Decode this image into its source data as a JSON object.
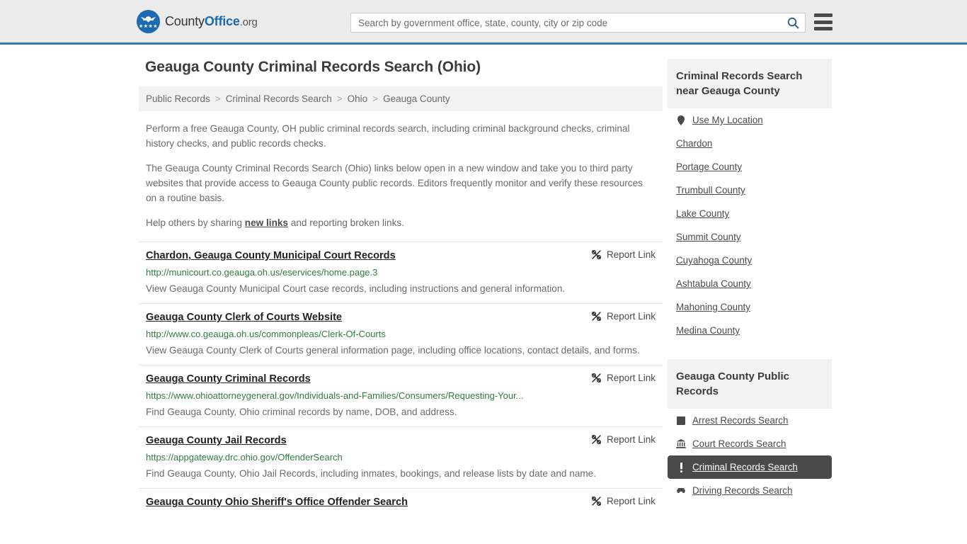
{
  "header": {
    "logo_text_1": "County",
    "logo_text_2": "Office",
    "logo_text_3": ".org",
    "logo_stars": "★★★★",
    "search_placeholder": "Search by government office, state, county, city or zip code",
    "search_value": "",
    "search_icon": "search-icon",
    "menu_icon": "hamburger-menu-icon"
  },
  "page_title": "Geauga County Criminal Records Search (Ohio)",
  "breadcrumb": {
    "items": [
      {
        "label": "Public Records"
      },
      {
        "label": "Criminal Records Search"
      },
      {
        "label": "Ohio"
      },
      {
        "label": "Geauga County"
      }
    ],
    "separator": ">"
  },
  "intro": {
    "p1": "Perform a free Geauga County, OH public criminal records search, including criminal background checks, criminal history checks, and public records checks.",
    "p2": "The Geauga County Criminal Records Search (Ohio) links below open in a new window and take you to third party websites that provide access to Geauga County public records. Editors frequently monitor and verify these resources on a routine basis.",
    "p3_before": "Help others by sharing ",
    "p3_link": "new links",
    "p3_after": " and reporting broken links."
  },
  "report_link_label": "Report Link",
  "report_link_icon": "broken-link-icon",
  "results": [
    {
      "title": "Chardon, Geauga County Municipal Court Records",
      "url": "http://municourt.co.geauga.oh.us/eservices/home.page.3",
      "description": "View Geauga County Municipal Court case records, including instructions and general information."
    },
    {
      "title": "Geauga County Clerk of Courts Website",
      "url": "http://www.co.geauga.oh.us/commonpleas/Clerk-Of-Courts",
      "description": "View Geauga County Clerk of Courts general information page, including office locations, contact details, and forms."
    },
    {
      "title": "Geauga County Criminal Records",
      "url": "https://www.ohioattorneygeneral.gov/Individuals-and-Families/Consumers/Requesting-Your...",
      "description": "Find Geauga County, Ohio criminal records by name, DOB, and address."
    },
    {
      "title": "Geauga County Jail Records",
      "url": "https://appgateway.drc.ohio.gov/OffenderSearch",
      "description": "Find Geauga County, Ohio Jail Records, including inmates, bookings, and release lists by date and name."
    },
    {
      "title": "Geauga County Ohio Sheriff's Office Offender Search",
      "url": "",
      "description": ""
    }
  ],
  "sidebar": {
    "nearby": {
      "title": "Criminal Records Search near Geauga County",
      "items": [
        {
          "label": "Use My Location",
          "icon": "map-pin-icon",
          "active": false
        },
        {
          "label": "Chardon",
          "icon": "",
          "active": false
        },
        {
          "label": "Portage County",
          "icon": "",
          "active": false
        },
        {
          "label": "Trumbull County",
          "icon": "",
          "active": false
        },
        {
          "label": "Lake County",
          "icon": "",
          "active": false
        },
        {
          "label": "Summit County",
          "icon": "",
          "active": false
        },
        {
          "label": "Cuyahoga County",
          "icon": "",
          "active": false
        },
        {
          "label": "Ashtabula County",
          "icon": "",
          "active": false
        },
        {
          "label": "Mahoning County",
          "icon": "",
          "active": false
        },
        {
          "label": "Medina County",
          "icon": "",
          "active": false
        }
      ]
    },
    "public_records": {
      "title": "Geauga County Public Records",
      "items": [
        {
          "label": "Arrest Records Search",
          "icon": "square-icon",
          "active": false
        },
        {
          "label": "Court Records Search",
          "icon": "bank-building-icon",
          "active": false
        },
        {
          "label": "Criminal Records Search",
          "icon": "exclamation-icon",
          "active": true
        },
        {
          "label": "Driving Records Search",
          "icon": "car-icon",
          "active": false
        }
      ]
    }
  },
  "colors": {
    "header_bg": "#ebebeb",
    "header_border": "#3b7ab0",
    "brand_blue": "#1c6bb0",
    "url_green": "#2f7d3e",
    "active_bg": "#4a4a4a",
    "panel_bg": "#f2f2f2"
  }
}
